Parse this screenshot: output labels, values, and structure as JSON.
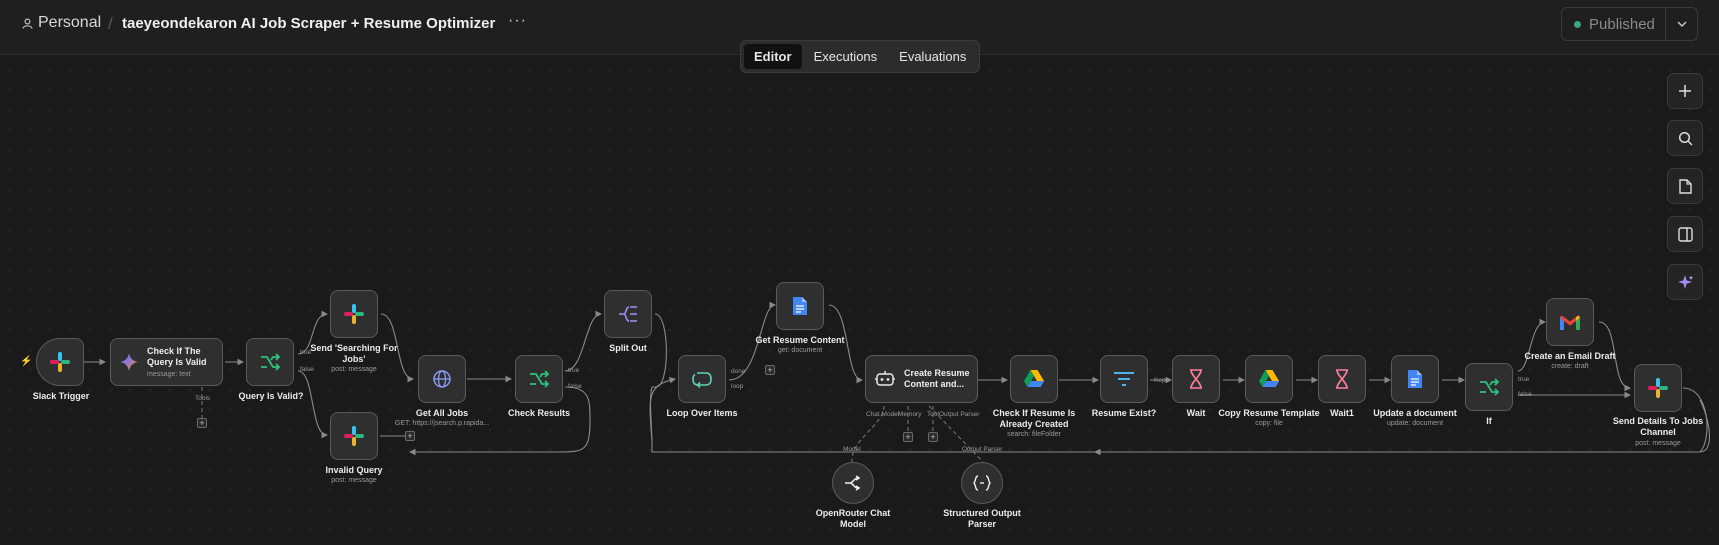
{
  "header": {
    "breadcrumb_personal": "Personal",
    "workflow_title": "taeyeondekaron AI Job Scraper + Resume Optimizer",
    "more_label": "···",
    "published_label": "Published"
  },
  "tabs": [
    {
      "label": "Editor",
      "active": true
    },
    {
      "label": "Executions",
      "active": false
    },
    {
      "label": "Evaluations",
      "active": false
    }
  ],
  "sidebar_tools": [
    "plus-icon",
    "search-icon",
    "sticky-note-icon",
    "panel-toggle-icon",
    "ai-sparkle-icon"
  ],
  "colors": {
    "canvas": "#1a1a1a",
    "published_dot": "#3aa77e",
    "trigger_bolt": "#ff6d3a",
    "if_green": "#2ec27e",
    "ai_purple": "#a78bfa",
    "docs_blue": "#4285f4",
    "wait_pink": "#ff7f9e"
  },
  "nodes": {
    "slack_trigger": {
      "label": "Slack Trigger",
      "icon": "slack-icon"
    },
    "check_query": {
      "label_1": "Check If The",
      "label_2": "Query Is Valid",
      "sub": "message: text",
      "icon": "gemini-icon",
      "port_tools": "Tools"
    },
    "query_valid": {
      "label": "Query Is Valid?",
      "icon": "if-icon",
      "port_true": "true",
      "port_false": "false"
    },
    "send_searching": {
      "label_1": "Send 'Searching For",
      "label_2": "Jobs'",
      "sub": "post: message",
      "icon": "slack-icon"
    },
    "invalid_query": {
      "label": "Invalid Query",
      "sub": "post: message",
      "icon": "slack-icon"
    },
    "get_all_jobs": {
      "label": "Get All Jobs",
      "sub": "GET: https://jsearch.p.rapida...",
      "icon": "globe-icon"
    },
    "check_results": {
      "label": "Check Results",
      "icon": "if-icon",
      "port_true": "true",
      "port_false": "false"
    },
    "split_out": {
      "label": "Split Out",
      "icon": "split-icon"
    },
    "loop_over_items": {
      "label": "Loop Over Items",
      "icon": "loop-icon",
      "port_done": "done",
      "port_loop": "loop"
    },
    "get_resume": {
      "label": "Get Resume Content",
      "sub": "get: document",
      "icon": "docs-icon"
    },
    "create_resume": {
      "label_1": "Create Resume",
      "label_2": "Content and...",
      "icon": "robot-icon",
      "port_chat": "Chat Model",
      "port_memory": "Memory",
      "port_tool": "Tool",
      "port_parser": "Output Parser"
    },
    "check_resume": {
      "label_1": "Check If Resume Is",
      "label_2": "Already Created",
      "sub": "search: fileFolder",
      "icon": "drive-icon"
    },
    "resume_exist": {
      "label": "Resume Exist?",
      "icon": "filter-icon",
      "port_kept": "Kept"
    },
    "wait": {
      "label": "Wait",
      "icon": "hourglass-icon"
    },
    "copy_template": {
      "label": "Copy Resume Template",
      "sub": "copy: file",
      "icon": "drive-icon"
    },
    "wait1": {
      "label": "Wait1",
      "icon": "hourglass-icon"
    },
    "update_document": {
      "label": "Update a document",
      "sub": "update: document",
      "icon": "docs-icon"
    },
    "if": {
      "label": "If",
      "icon": "if-icon",
      "port_true": "true",
      "port_false": "false"
    },
    "email_draft": {
      "label": "Create an Email Draft",
      "sub": "create: draft",
      "icon": "gmail-icon"
    },
    "send_details": {
      "label_1": "Send Details To Jobs",
      "label_2": "Channel",
      "sub": "post: message",
      "icon": "slack-icon"
    },
    "openrouter": {
      "label_1": "OpenRouter Chat",
      "label_2": "Model",
      "port": "Model",
      "icon": "openrouter-icon"
    },
    "structured_parser": {
      "label_1": "Structured Output",
      "label_2": "Parser",
      "port": "Output Parser",
      "icon": "braces-icon"
    }
  }
}
